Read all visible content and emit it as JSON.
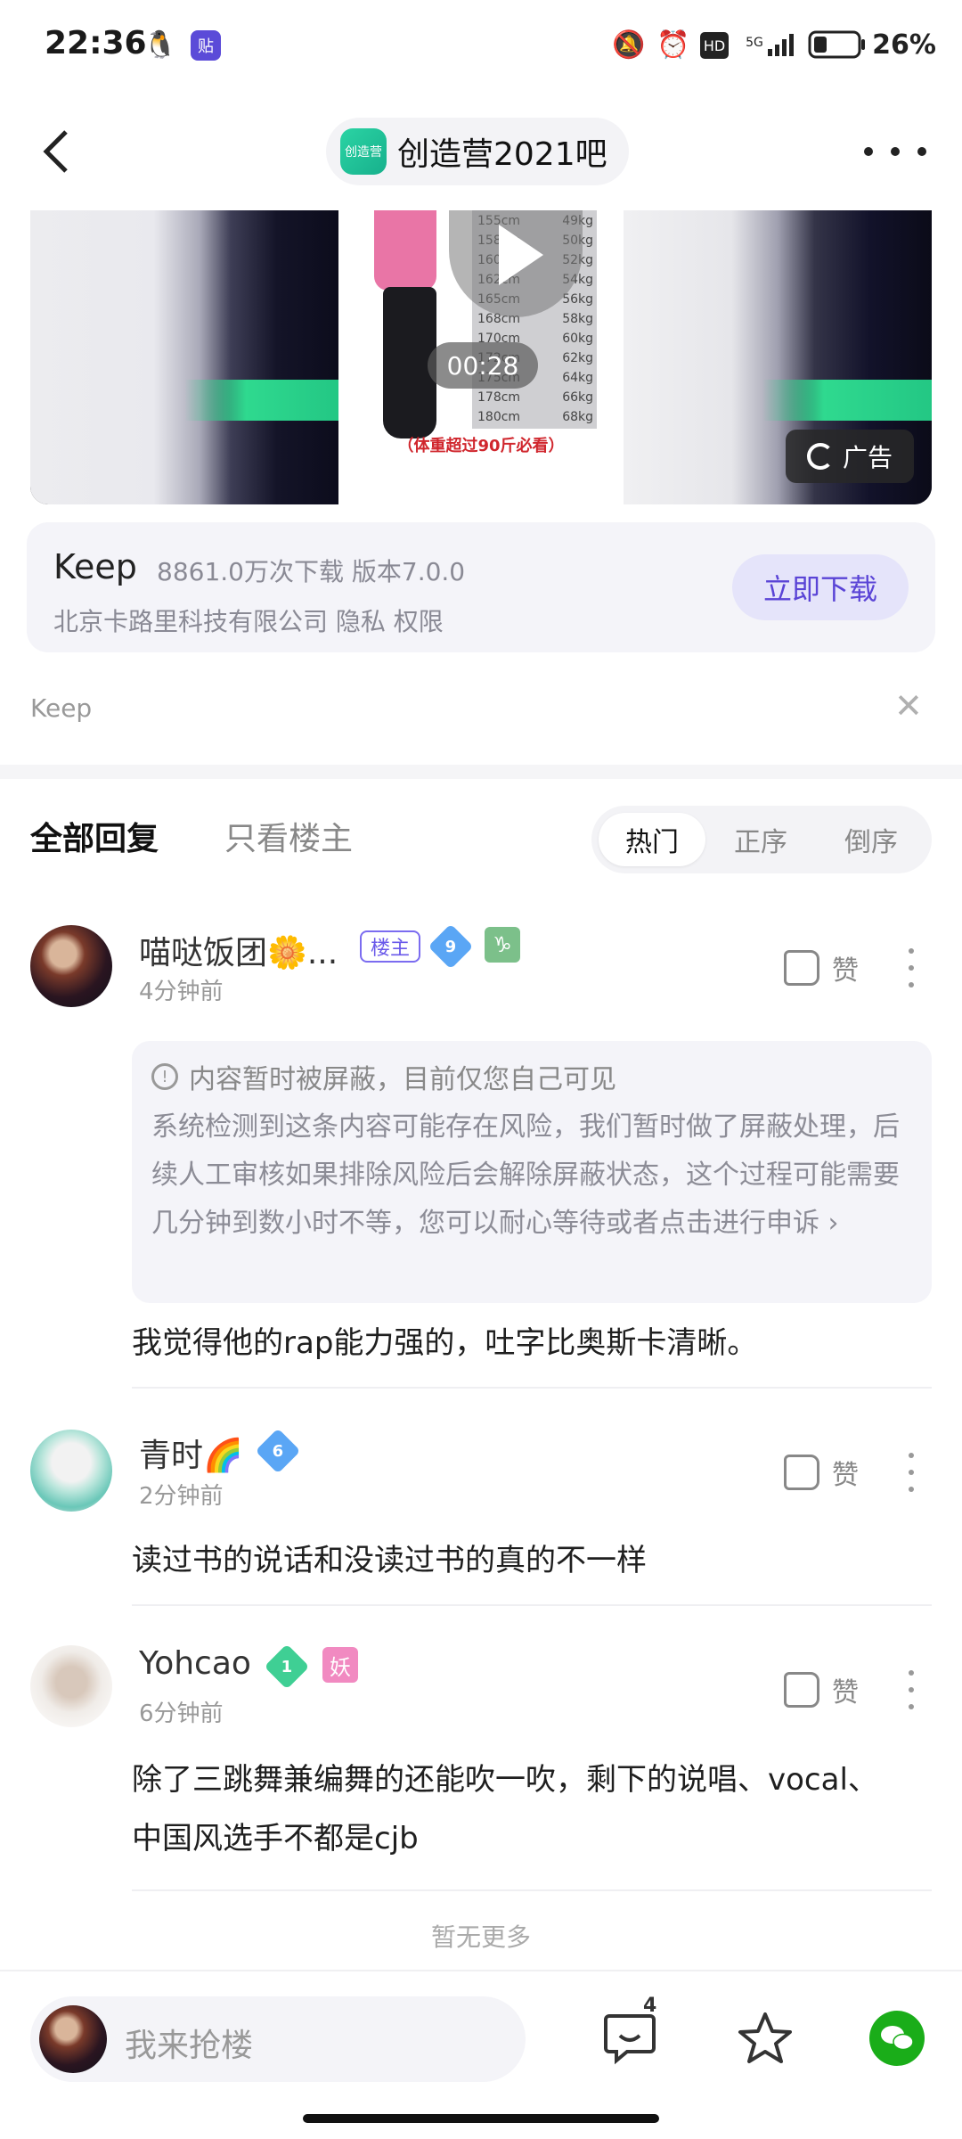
{
  "status_bar": {
    "time": "22:36",
    "network": "5G",
    "battery": "26%",
    "hd_label": "HD",
    "app_icon_label": "贴"
  },
  "nav": {
    "forum_name": "创造营2021吧",
    "forum_logo_text": "创造营"
  },
  "ad": {
    "duration": "00:28",
    "caption": "（体重超过90斤必看）",
    "badge": "广告",
    "table": [
      {
        "h": "155cm",
        "w": "49kg"
      },
      {
        "h": "158cm",
        "w": "50kg"
      },
      {
        "h": "160cm",
        "w": "52kg"
      },
      {
        "h": "162cm",
        "w": "54kg"
      },
      {
        "h": "165cm",
        "w": "56kg"
      },
      {
        "h": "168cm",
        "w": "58kg"
      },
      {
        "h": "170cm",
        "w": "60kg"
      },
      {
        "h": "172cm",
        "w": "62kg"
      },
      {
        "h": "175cm",
        "w": "64kg"
      },
      {
        "h": "178cm",
        "w": "66kg"
      },
      {
        "h": "180cm",
        "w": "68kg"
      }
    ],
    "app_name": "Keep",
    "app_meta": "8861.0万次下载  版本7.0.0",
    "company": "北京卡路里科技有限公司   隐私   权限",
    "download_label": "立即下载",
    "source": "Keep",
    "close": "✕"
  },
  "tabs": {
    "all": "全部回复",
    "op_only": "只看楼主",
    "sort": [
      "热门",
      "正序",
      "倒序"
    ]
  },
  "comments": [
    {
      "username": "喵哒饭团🌼...",
      "op_badge": "楼主",
      "level": "9",
      "time": "4分钟前",
      "like": "赞",
      "blocked_title": "内容暂时被屏蔽，目前仅您自己可见",
      "blocked_desc": "系统检测到这条内容可能存在风险，我们暂时做了屏蔽处理，后续人工审核如果排除风险后会解除屏蔽状态，这个过程可能需要几分钟到数小时不等，您可以耐心等待或者点击进行申诉 ›",
      "text": "我觉得他的rap能力强的，吐字比奥斯卡清晰。"
    },
    {
      "username": "青时🌈",
      "level": "6",
      "time": "2分钟前",
      "like": "赞",
      "text": "读过书的说话和没读过书的真的不一样"
    },
    {
      "username": "Yohcao",
      "level": "1",
      "tag": "妖",
      "time": "6分钟前",
      "like": "赞",
      "text": "除了三跳舞兼编舞的还能吹一吹，剩下的说唱、vocal、中国风选手不都是cjb"
    }
  ],
  "no_more": "暂无更多",
  "bottom": {
    "placeholder": "我来抢楼",
    "comment_count": "4"
  },
  "colors": {
    "accent": "#5a44d6",
    "wechat": "#1aad19",
    "green": "#23c784"
  }
}
